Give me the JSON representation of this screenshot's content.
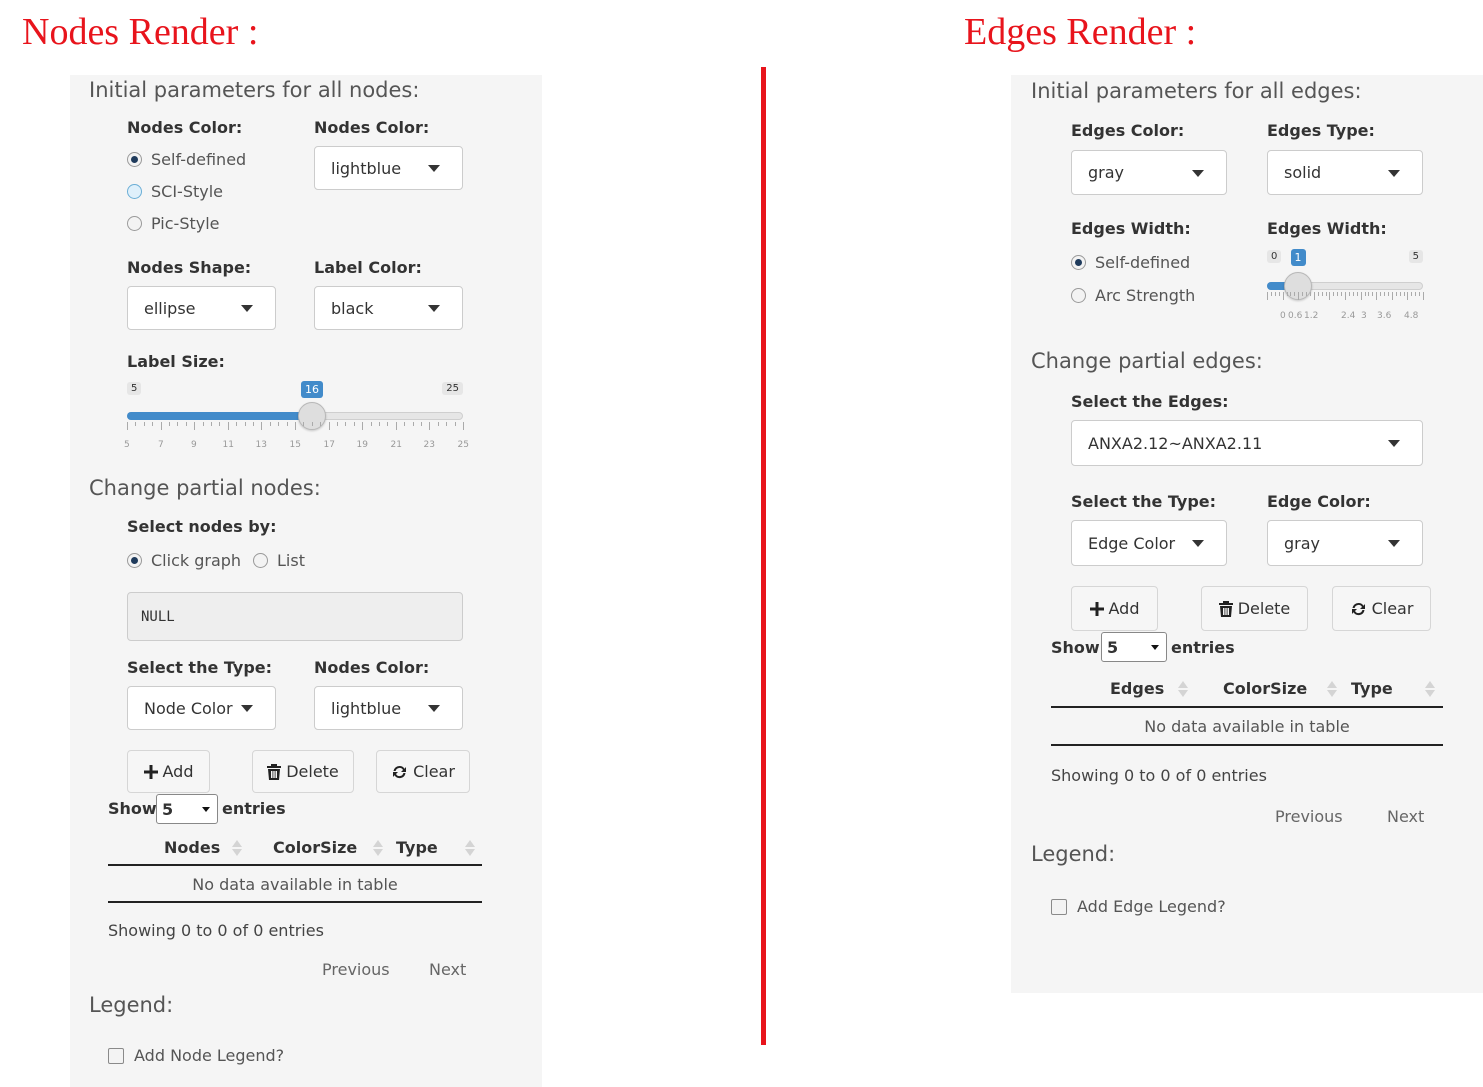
{
  "titles": {
    "nodes": "Nodes Render :",
    "edges": "Edges Render :"
  },
  "colors": {
    "title": "#e8141c",
    "divider": "#e8141c",
    "slider": "#428bca"
  },
  "nodes": {
    "initial_heading": "Initial parameters for all nodes:",
    "nodes_color_label": "Nodes Color:",
    "color_options": [
      "Self-defined",
      "SCI-Style",
      "Pic-Style"
    ],
    "nodes_color_label_2": "Nodes Color:",
    "nodes_color_value": "lightblue",
    "shape_label": "Nodes Shape:",
    "shape_value": "ellipse",
    "label_color_label": "Label Color:",
    "label_color_value": "black",
    "label_size_label": "Label Size:",
    "label_size_slider": {
      "min": "5",
      "max": "25",
      "value": "16",
      "fraction": 0.55,
      "grid": [
        "5",
        "7",
        "9",
        "11",
        "13",
        "15",
        "17",
        "19",
        "21",
        "23",
        "25"
      ]
    },
    "partial_heading": "Change partial nodes:",
    "select_by_label": "Select nodes by:",
    "select_by_options": [
      "Click graph",
      "List"
    ],
    "selected_text": "NULL",
    "type_label": "Select the Type:",
    "type_value": "Node Color",
    "nodes_color_label_3": "Nodes Color:",
    "nodes_color_value_2": "lightblue",
    "buttons": {
      "add": "Add",
      "delete": "Delete",
      "clear": "Clear"
    },
    "show_label": "Show",
    "show_value": "5",
    "entries_label": "entries",
    "table": {
      "columns": [
        "Nodes",
        "ColorSize",
        "Type"
      ],
      "empty": "No data available in table"
    },
    "info": "Showing 0 to 0 of 0 entries",
    "prev": "Previous",
    "next": "Next",
    "legend_heading": "Legend:",
    "legend_checkbox": "Add Node Legend?"
  },
  "edges": {
    "initial_heading": "Initial parameters for all edges:",
    "color_label": "Edges Color:",
    "color_value": "gray",
    "type_label": "Edges Type:",
    "type_value": "solid",
    "width_label": "Edges Width:",
    "width_options": [
      "Self-defined",
      "Arc Strength"
    ],
    "width_label_2": "Edges Width:",
    "width_slider": {
      "min": "0",
      "max": "5",
      "value": "1",
      "fraction": 0.2,
      "grid": [
        "0",
        "0.6",
        "1.2",
        "2.4",
        "3",
        "3.6",
        "4.8"
      ]
    },
    "partial_heading": "Change partial edges:",
    "select_edges_label": "Select the Edges:",
    "select_edges_value": "ANXA2.12~ANXA2.11",
    "select_type_label": "Select the Type:",
    "select_type_value": "Edge Color",
    "edge_color_label": "Edge Color:",
    "edge_color_value": "gray",
    "buttons": {
      "add": "Add",
      "delete": "Delete",
      "clear": "Clear"
    },
    "show_label": "Show",
    "show_value": "5",
    "entries_label": "entries",
    "table": {
      "columns": [
        "Edges",
        "ColorSize",
        "Type"
      ],
      "empty": "No data available in table"
    },
    "info": "Showing 0 to 0 of 0 entries",
    "prev": "Previous",
    "next": "Next",
    "legend_heading": "Legend:",
    "legend_checkbox": "Add Edge Legend?"
  }
}
